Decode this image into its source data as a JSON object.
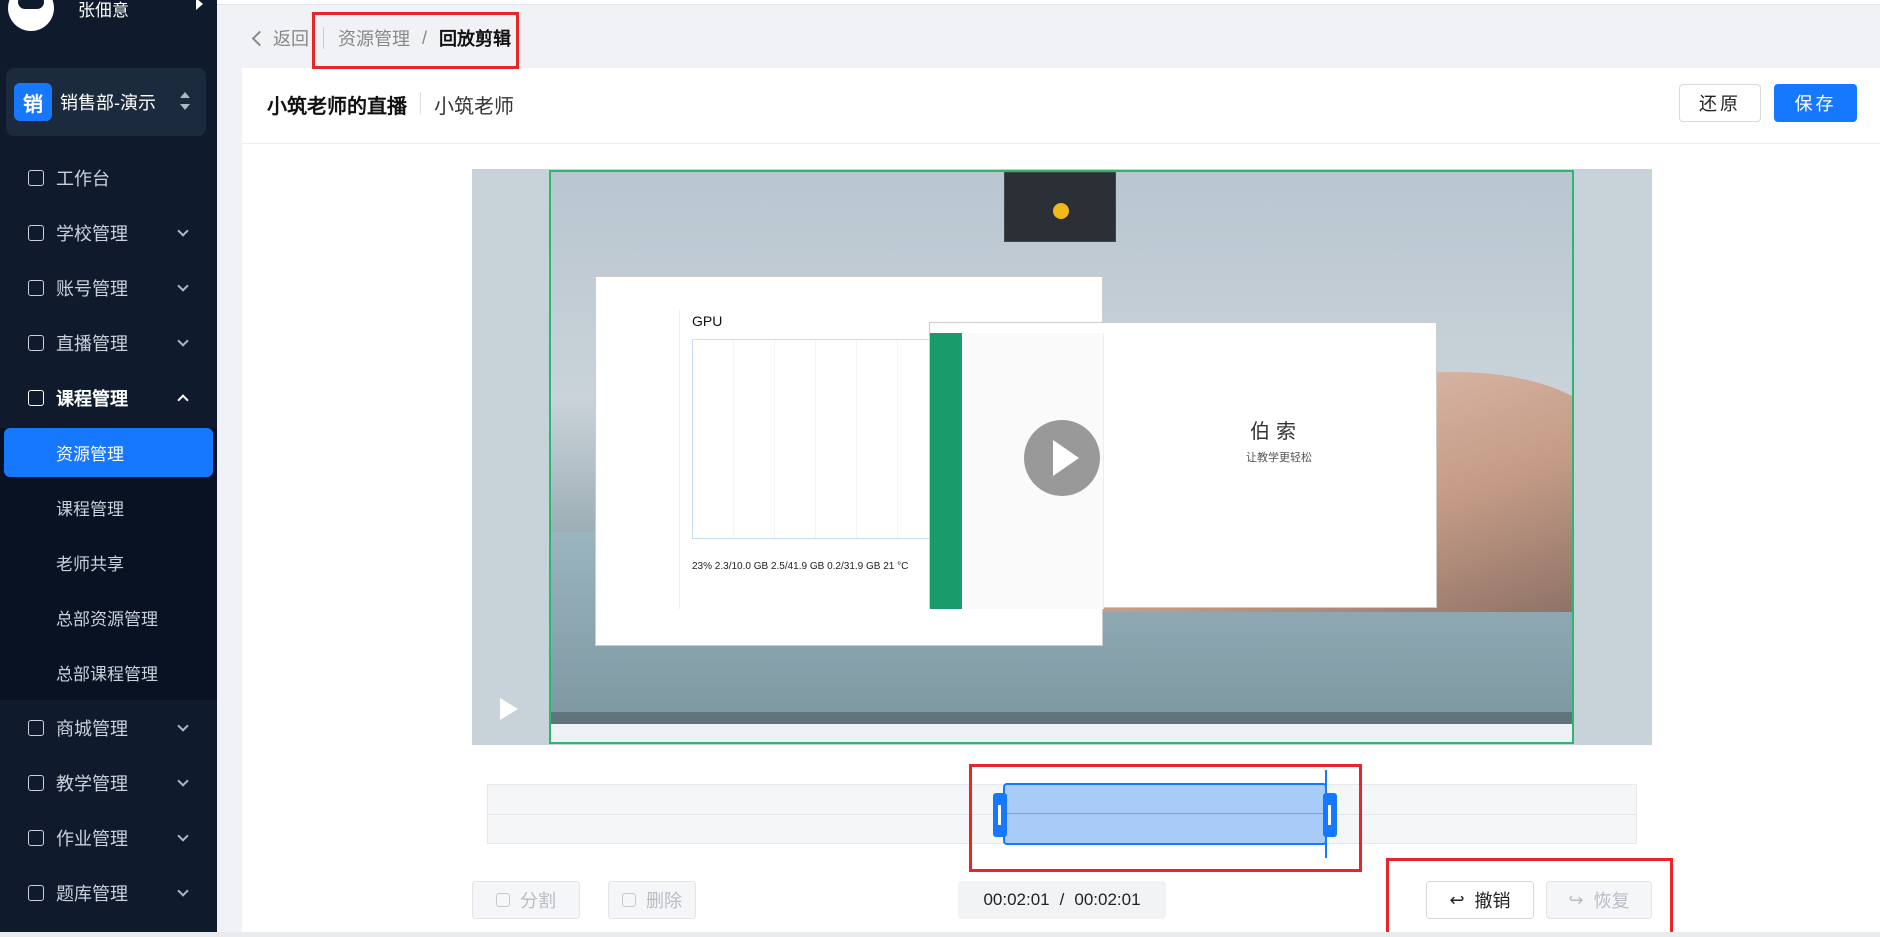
{
  "sidebar": {
    "user_name": "张佃意",
    "dept_badge": "销",
    "dept_name": "销售部-演示",
    "menu": [
      {
        "label": "工作台"
      },
      {
        "label": "学校管理"
      },
      {
        "label": "账号管理"
      },
      {
        "label": "直播管理"
      },
      {
        "label": "课程管理"
      }
    ],
    "submenu": [
      {
        "label": "资源管理"
      },
      {
        "label": "课程管理"
      },
      {
        "label": "老师共享"
      },
      {
        "label": "总部资源管理"
      },
      {
        "label": "总部课程管理"
      }
    ],
    "menu_after": [
      {
        "label": "商城管理"
      },
      {
        "label": "教学管理"
      },
      {
        "label": "作业管理"
      },
      {
        "label": "题库管理"
      }
    ]
  },
  "breadcrumb": {
    "back": "返回",
    "parent": "资源管理",
    "separator": "/",
    "current": "回放剪辑"
  },
  "header": {
    "course_title": "小筑老师的直播",
    "teacher": "小筑老师",
    "restore_label": "还原",
    "save_label": "保存"
  },
  "video": {
    "task_manager_heading": "GPU",
    "task_manager_stats": "23%   2.3/10.0 GB   2.5/41.9 GB   0.2/31.9 GB   21 °C",
    "app_brand": "伯索",
    "app_slogan": "让教学更轻松"
  },
  "editor": {
    "split_label": "分割",
    "delete_label": "删除",
    "current_time": "00:02:01",
    "time_separator": "/",
    "total_time": "00:02:01",
    "undo_label": "撤销",
    "redo_label": "恢复",
    "clip_start_fraction": 0.523,
    "clip_end_fraction": 0.76
  },
  "colors": {
    "accent": "#1677ff",
    "sidebar_bg": "#0f1b2d",
    "annotation": "#e8262a",
    "video_border": "#2bb673"
  },
  "icons": {
    "back": "chevron-left-icon",
    "play": "play-icon",
    "split": "scissors-icon",
    "delete": "trash-icon",
    "undo": "undo-icon",
    "redo": "redo-icon"
  }
}
